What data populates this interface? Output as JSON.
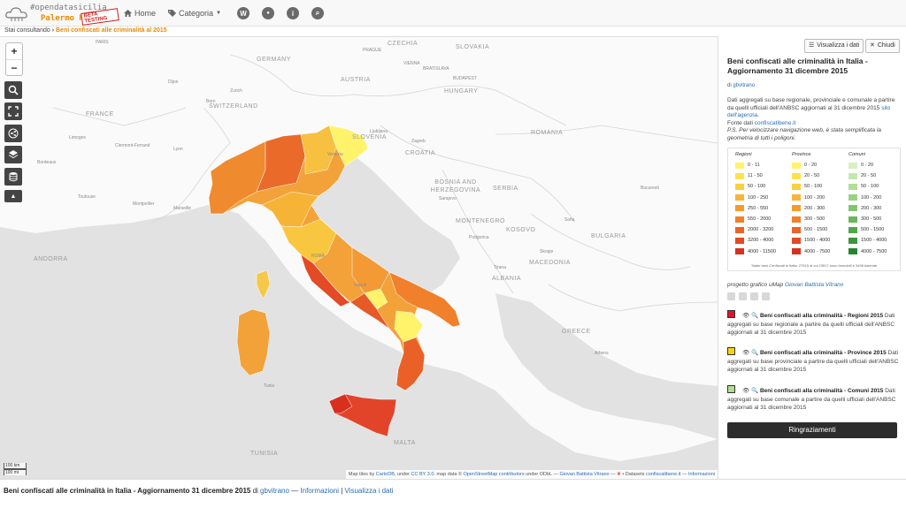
{
  "header": {
    "brand_tag": "#opendatasicilia",
    "brand_city": "Palermo Hub",
    "beta_badge": "BETA TESTING",
    "nav": [
      {
        "label": "Home",
        "icon": "home-icon"
      },
      {
        "label": "Categoria",
        "icon": "tag-icon"
      }
    ],
    "icon_buttons": [
      {
        "glyph": "W",
        "icon": "wikipedia-icon"
      },
      {
        "glyph": "●",
        "icon": "settings-icon"
      },
      {
        "glyph": "i",
        "icon": "info-icon"
      },
      {
        "glyph": "⌕",
        "icon": "search-icon"
      }
    ]
  },
  "breadcrumb": {
    "prefix": "Stai consultando",
    "current": "Beni confiscati alle criminalità al 2015"
  },
  "map": {
    "zoom_in": "+",
    "zoom_out": "−",
    "countries": [
      "GERMANY",
      "CZECHIA",
      "SLOVAKIA",
      "AUSTRIA",
      "HUNGARY",
      "SWITZERLAND",
      "FRANCE",
      "SLOVENIA",
      "CROATIA",
      "ROMANIA",
      "BOSNIA AND HERZEGOVINA",
      "SERBIA",
      "MONTENEGRO",
      "KOSOVO",
      "BULGARIA",
      "ANDORRA",
      "MACEDONIA",
      "ALBANIA",
      "MALTA",
      "TUNISIA",
      "GREECE"
    ],
    "cities": [
      "PARIS",
      "PRAGUE",
      "VIENNA",
      "BRATISLAVA",
      "BUDAPEST",
      "Dijon",
      "Zurich",
      "Bern",
      "Limoges",
      "Bordeaux",
      "Toulouse",
      "Clermont-Ferrand",
      "Lyon",
      "Venezia",
      "Zagreb",
      "Ljubljana",
      "Sarajevo",
      "Podgorica",
      "Skopje",
      "Sofia",
      "Tirana",
      "Bucuresti",
      "Montpellier",
      "Marseille",
      "ROMA",
      "Napoli",
      "Tunis",
      "Athens"
    ],
    "scale_km": "100 km",
    "scale_mi": "100 mi",
    "attribution": {
      "a": "Map tiles by ",
      "carto": "CartoDB",
      "b": ", under ",
      "ccby": "CC BY 3.0",
      "c": ". map data © ",
      "osm": "OpenStreetMap contributors",
      "d": " under ODbL — ",
      "author": "Giovan Battista Vitrano",
      "e": " — ",
      "f": " • Datasets ",
      "ds": "confiscatibene.it",
      "g": " — ",
      "info": "Informazioni"
    }
  },
  "panel": {
    "view_data_btn": "Visualizza i dati",
    "close_btn": "Chiudi",
    "title": "Beni confiscati alle criminalità in Italia - Aggiornamento 31 dicembre 2015",
    "author_prefix": "di ",
    "author": "gbvitrano",
    "desc_1": "Dati aggregati su base regionale, provinciale e comunale a partire da quelli ufficiali dell'ANBSC aggiornati al 31 dicembre 2015 ",
    "desc_link": "sito dell'agenzia",
    "desc_2": ".",
    "source_prefix": "Fonte dati ",
    "source_link": "confiscatibene.it",
    "ps": "P.S. Per velocizzare navigazione web, è stata semplificata la geometria di tutti i poligoni.",
    "legend": {
      "columns": [
        {
          "header": "Regioni",
          "rows": [
            "0 - 11",
            "11 - 50",
            "50 - 100",
            "100 - 250",
            "250 - 550",
            "550 - 2000",
            "2000 - 3200",
            "3200 - 4000",
            "4000 - 11500"
          ],
          "colors": [
            "#fff36b",
            "#fde24d",
            "#fbd03e",
            "#f9b536",
            "#f59a30",
            "#f0802c",
            "#ea6428",
            "#e24a24",
            "#d8301f"
          ]
        },
        {
          "header": "Province",
          "rows": [
            "0 - 20",
            "20 - 50",
            "50 - 100",
            "100 - 200",
            "200 - 300",
            "300 - 500",
            "500 - 1500",
            "1500 - 4000",
            "4000 - 7500"
          ],
          "colors": [
            "#fff36b",
            "#fde24d",
            "#fbd03e",
            "#f9b536",
            "#f59a30",
            "#f0802c",
            "#ea6428",
            "#e24a24",
            "#d8301f"
          ]
        },
        {
          "header": "Comuni",
          "rows": [
            "0 - 20",
            "20 - 50",
            "50 - 100",
            "100 - 200",
            "200 - 300",
            "300 - 500",
            "500 - 1500",
            "1500 - 4000",
            "4000 - 7500"
          ],
          "colors": [
            "#d7efc2",
            "#c5e7ad",
            "#b1de98",
            "#9ad283",
            "#82c56f",
            "#69b65d",
            "#52a64c",
            "#3c963d",
            "#258530"
          ]
        }
      ],
      "note": "Totale beni Confiscati in Italia: 27915 di cui 23517 sono Immobili e 3498 Aziende"
    },
    "project_prefix": "progetto grafico uMap ",
    "project_author": "Giovan Battista Vitrano",
    "layers": [
      {
        "color": "#d8162f",
        "name": "Beni confiscati alla criminalità - Regioni 2015",
        "desc": " Dati aggregati su base regionale a partire da quelli ufficiali dell'ANBSC aggiornati al 31 dicembre 2015"
      },
      {
        "color": "#f7d312",
        "name": "Beni confiscati alla criminalità - Province 2015",
        "desc": " Dati aggregati su base provinciale a partire da quelli ufficiali dell'ANBSC aggiornati al 31 dicembre 2015"
      },
      {
        "color": "#b5dc8c",
        "name": "Beni confiscati alla criminalità - Comuni 2015",
        "desc": " Dati aggregati su base comunale a partire da quelli ufficiali dell'ANBSC aggiornati al 31 dicembre 2015"
      }
    ],
    "thanks_btn": "Ringraziamenti"
  },
  "footer": {
    "title": "Beni confiscati alle criminalità in Italia - Aggiornamento 31 dicembre 2015",
    "by": " di ",
    "author": "gbvitrano",
    "sep1": " — ",
    "info": "Informazioni",
    "sep2": " | ",
    "view": "Visualizza i dati"
  }
}
